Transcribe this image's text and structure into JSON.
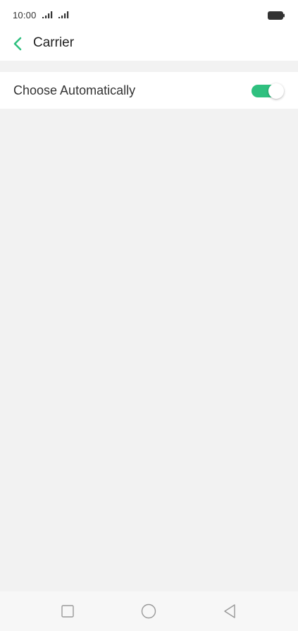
{
  "status_bar": {
    "time": "10:00",
    "icons": [
      "signal-bars-icon",
      "signal-bars-icon",
      "battery-icon"
    ]
  },
  "header": {
    "title": "Carrier",
    "back_icon": "chevron-left-icon"
  },
  "settings": {
    "choose_automatically": {
      "label": "Choose Automatically",
      "enabled": true
    }
  },
  "nav_bar": {
    "icons": [
      "square-recents-icon",
      "circle-home-icon",
      "triangle-back-icon"
    ]
  },
  "colors": {
    "accent": "#2fc07f",
    "background": "#f2f2f2",
    "surface": "#ffffff"
  }
}
